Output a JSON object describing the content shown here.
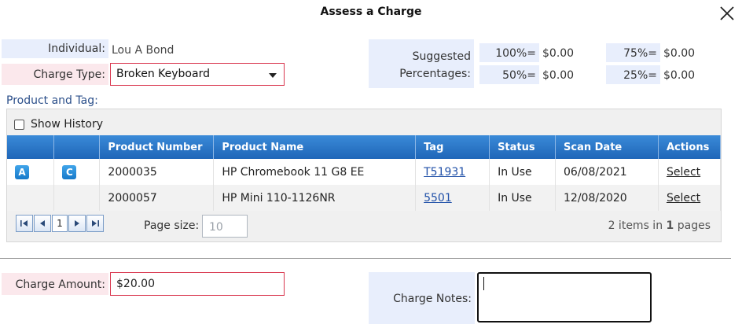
{
  "dialog": {
    "title": "Assess a Charge"
  },
  "individual": {
    "label": "Individual:",
    "value": "Lou A Bond"
  },
  "charge_type": {
    "label": "Charge Type:",
    "value": "Broken Keyboard"
  },
  "suggested": {
    "label_line1": "Suggested",
    "label_line2": "Percentages:",
    "items": [
      {
        "pct": "100%=",
        "value": "$0.00"
      },
      {
        "pct": "75%=",
        "value": "$0.00"
      },
      {
        "pct": "50%=",
        "value": "$0.00"
      },
      {
        "pct": "25%=",
        "value": "$0.00"
      }
    ]
  },
  "product_section": {
    "title": "Product and Tag:",
    "show_history": "Show History"
  },
  "grid": {
    "columns": [
      "",
      "",
      "Product Number",
      "Product Name",
      "Tag",
      "Status",
      "Scan Date",
      "Actions"
    ],
    "rows": [
      {
        "badge_a": "A",
        "badge_c": "C",
        "number": "2000035",
        "name": "HP Chromebook 11 G8 EE",
        "tag": "T51931",
        "status": "In Use",
        "date": "06/08/2021",
        "action": "Select"
      },
      {
        "number": "2000057",
        "name": "HP Mini 110-1126NR",
        "tag": "5501",
        "status": "In Use",
        "date": "12/08/2020",
        "action": "Select"
      }
    ]
  },
  "pager": {
    "current_page": "1",
    "page_size_label": "Page size:",
    "page_size": "10",
    "items_count": "2",
    "items_text_1": " items in ",
    "pages_count": "1",
    "items_text_2": " pages"
  },
  "charge_amount": {
    "label": "Charge Amount:",
    "value": "$20.00"
  },
  "charge_notes": {
    "label": "Charge Notes:"
  }
}
